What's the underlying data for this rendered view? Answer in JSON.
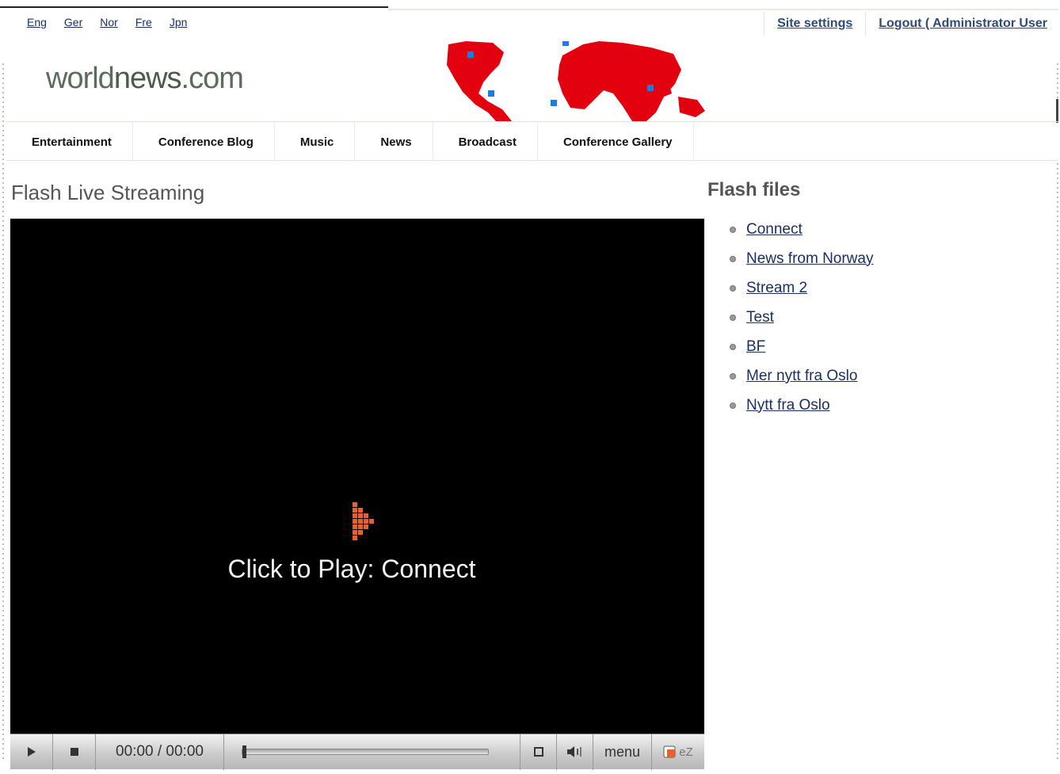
{
  "languages": [
    "Eng",
    "Ger",
    "Nor",
    "Fre",
    "Jpn"
  ],
  "admin": {
    "site_settings": "Site settings",
    "logout": "Logout ( Administrator User"
  },
  "logo": {
    "part1": "world",
    "part2": "news",
    "part3": ".com"
  },
  "nav": [
    "Entertainment",
    "Conference Blog",
    "Music",
    "News",
    "Broadcast",
    "Conference Gallery"
  ],
  "page": {
    "title": "Flash Live Streaming"
  },
  "player": {
    "caption": "Click to Play: Connect",
    "time": "00:00 / 00:00",
    "menu_label": "menu",
    "logo_text": "eZ",
    "progress": 0,
    "accent_color": "#e8602c"
  },
  "sidebar": {
    "title": "Flash files",
    "files": [
      "Connect",
      "News from Norway",
      "Stream 2",
      "Test",
      "BF",
      "Mer nytt fra Oslo",
      "Nytt fra Oslo"
    ]
  },
  "colors": {
    "map": "#e3000f",
    "map_marker": "#1e7be0",
    "link": "#1a2f66"
  }
}
